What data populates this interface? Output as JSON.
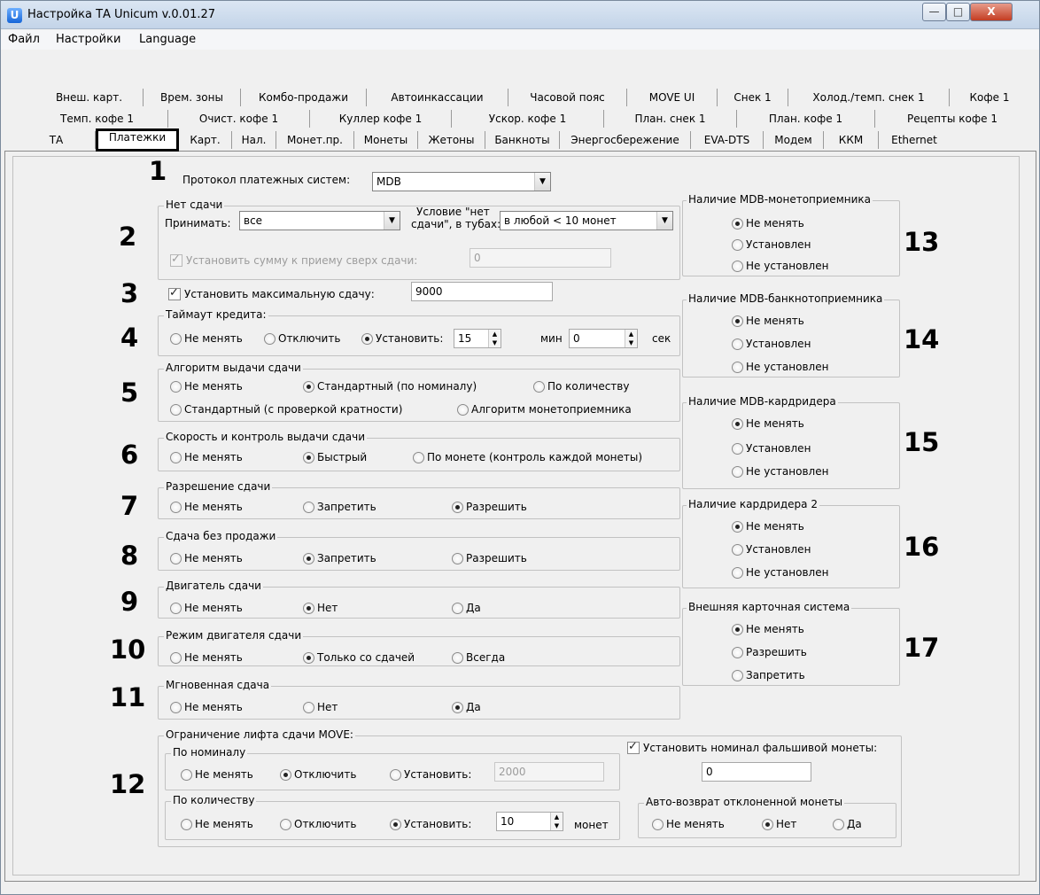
{
  "window": {
    "title": "Настройка ТА Unicum v.0.01.27",
    "icon": "U",
    "btn_min": "—",
    "btn_max": "□",
    "btn_close": "X"
  },
  "menu": [
    "Файл",
    "Настройки",
    "Language"
  ],
  "tabs_row1": [
    "Внеш. карт.",
    "Врем. зоны",
    "Комбо-продажи",
    "Автоинкассации",
    "Часовой пояс",
    "MOVE UI",
    "Снек 1",
    "Холод./темп. снек 1",
    "Кофе 1"
  ],
  "tabs_row2": [
    "Темп. кофе 1",
    "Очист. кофе 1",
    "Куллер кофе 1",
    "Ускор. кофе 1",
    "План. снек 1",
    "План. кофе 1",
    "Рецепты кофе 1"
  ],
  "tabs_row3": [
    "ТА",
    "Платежки",
    "Карт.",
    "Нал.",
    "Монет.пр.",
    "Монеты",
    "Жетоны",
    "Банкноты",
    "Энергосбережение",
    "EVA-DTS",
    "Модем",
    "ККМ",
    "Ethernet"
  ],
  "numbers": [
    "1",
    "2",
    "3",
    "4",
    "5",
    "6",
    "7",
    "8",
    "9",
    "10",
    "11",
    "12",
    "13",
    "14",
    "15",
    "16",
    "17"
  ],
  "protocol": {
    "label": "Протокол платежных систем:",
    "value": "MDB"
  },
  "no_change": {
    "title": "Нет сдачи",
    "accept_label": "Принимать:",
    "accept_value": "все",
    "cond_label_1": "Условие \"нет",
    "cond_label_2": "сдачи\", в тубах:",
    "cond_value": "в любой < 10 монет",
    "set_sum_label": "Установить сумму к приему сверх сдачи:",
    "set_sum_value": "0"
  },
  "max_change": {
    "label": "Установить максимальную сдачу:",
    "value": "9000"
  },
  "credit_timeout": {
    "title": "Таймаут кредита:",
    "opt1": "Не менять",
    "opt2": "Отключить",
    "opt3": "Установить:",
    "min_value": "15",
    "min_label": "мин",
    "sec_value": "0",
    "sec_label": "сек"
  },
  "algo": {
    "title": "Алгоритм выдачи сдачи",
    "opt1": "Не менять",
    "opt2": "Стандартный (по номиналу)",
    "opt3": "По количеству",
    "opt4": "Стандартный (с проверкой кратности)",
    "opt5": "Алгоритм монетоприемника"
  },
  "speed": {
    "title": "Скорость и контроль выдачи сдачи",
    "opt1": "Не менять",
    "opt2": "Быстрый",
    "opt3": "По монете (контроль каждой монеты)"
  },
  "allow_change": {
    "title": "Разрешение сдачи",
    "opt1": "Не менять",
    "opt2": "Запретить",
    "opt3": "Разрешить"
  },
  "change_no_sale": {
    "title": "Сдача без продажи",
    "opt1": "Не менять",
    "opt2": "Запретить",
    "opt3": "Разрешить"
  },
  "change_motor": {
    "title": "Двигатель сдачи",
    "opt1": "Не менять",
    "opt2": "Нет",
    "opt3": "Да"
  },
  "motor_mode": {
    "title": "Режим двигателя сдачи",
    "opt1": "Не менять",
    "opt2": "Только со сдачей",
    "opt3": "Всегда"
  },
  "instant": {
    "title": "Мгновенная сдача",
    "opt1": "Не менять",
    "opt2": "Нет",
    "opt3": "Да"
  },
  "lift": {
    "title": "Ограничение лифта сдачи MOVE:",
    "nominal_title": "По номиналу",
    "nom_opt1": "Не менять",
    "nom_opt2": "Отключить",
    "nom_opt3": "Установить:",
    "nom_value": "2000",
    "qty_title": "По количеству",
    "qty_opt1": "Не менять",
    "qty_opt2": "Отключить",
    "qty_opt3": "Установить:",
    "qty_value": "10",
    "qty_unit": "монет"
  },
  "fake_coin": {
    "label": "Установить номинал фальшивой монеты:",
    "value": "0"
  },
  "auto_return": {
    "title": "Авто-возврат отклоненной монеты",
    "opt1": "Не менять",
    "opt2": "Нет",
    "opt3": "Да"
  },
  "mdb_coin": {
    "title": "Наличие MDB-монетоприемника",
    "opt1": "Не менять",
    "opt2": "Установлен",
    "opt3": "Не установлен"
  },
  "mdb_bill": {
    "title": "Наличие MDB-банкнотоприемника",
    "opt1": "Не менять",
    "opt2": "Установлен",
    "opt3": "Не установлен"
  },
  "mdb_card": {
    "title": "Наличие MDB-кардридера",
    "opt1": "Не менять",
    "opt2": "Установлен",
    "opt3": "Не установлен"
  },
  "card2": {
    "title": "Наличие кардридера 2",
    "opt1": "Не менять",
    "opt2": "Установлен",
    "opt3": "Не установлен"
  },
  "ext_card": {
    "title": "Внешняя карточная система",
    "opt1": "Не менять",
    "opt2": "Разрешить",
    "opt3": "Запретить"
  }
}
